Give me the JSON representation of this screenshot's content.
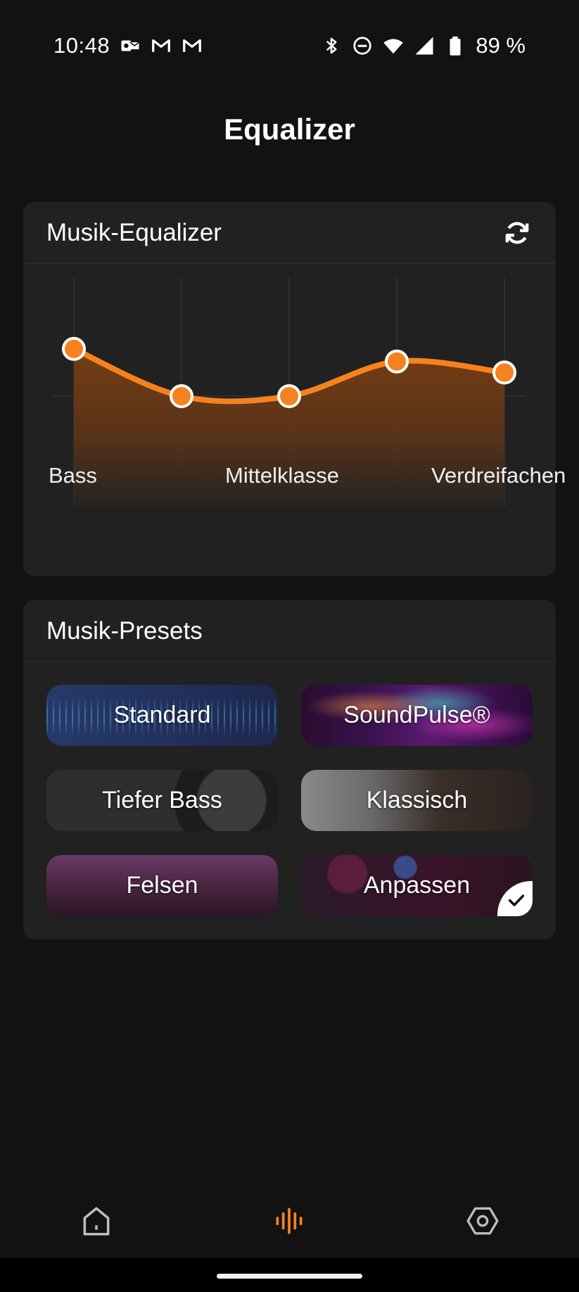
{
  "status_bar": {
    "time": "10:48",
    "battery_percent": "89 %",
    "left_icons": [
      "outlook-icon",
      "gmail-icon",
      "gmail-icon"
    ],
    "right_icons": [
      "bluetooth-icon",
      "do-not-disturb-icon",
      "wifi-icon",
      "cell-signal-icon",
      "battery-icon"
    ]
  },
  "page": {
    "title": "Equalizer"
  },
  "equalizer": {
    "header": "Musik-Equalizer",
    "refresh_icon": "refresh-icon",
    "accent": "#f5821f",
    "band_labels": [
      "Bass",
      "Mittelklasse",
      "Verdreifachen"
    ],
    "bands": [
      {
        "level": 0.8
      },
      {
        "level": 0.5
      },
      {
        "level": 0.5
      },
      {
        "level": 0.72
      },
      {
        "level": 0.65
      }
    ]
  },
  "presets": {
    "header": "Musik-Presets",
    "items": [
      {
        "label": "Standard",
        "selected": false
      },
      {
        "label": "SoundPulse®",
        "selected": false
      },
      {
        "label": "Tiefer Bass",
        "selected": false
      },
      {
        "label": "Klassisch",
        "selected": false
      },
      {
        "label": "Felsen",
        "selected": false
      },
      {
        "label": "Anpassen",
        "selected": true
      }
    ]
  },
  "bottom_nav": {
    "items": [
      {
        "icon": "home-icon",
        "active": false
      },
      {
        "icon": "equalizer-bars-icon",
        "active": true
      },
      {
        "icon": "settings-hexagon-icon",
        "active": false
      }
    ],
    "active_color": "#f5821f",
    "inactive_color": "#bdbdbd"
  }
}
